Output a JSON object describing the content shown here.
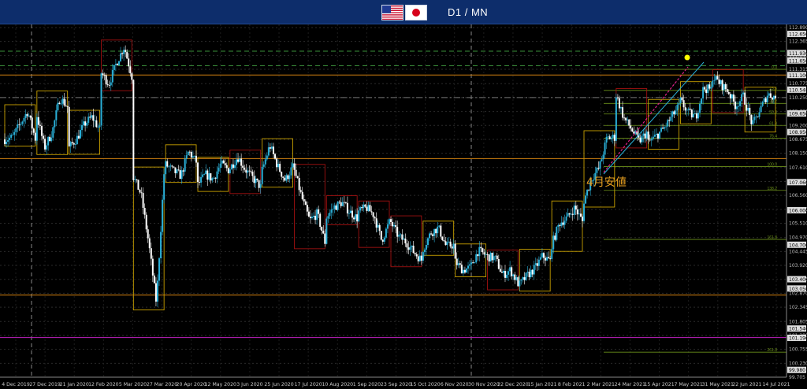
{
  "header": {
    "title": "D1 / MN",
    "flag_left": "us-flag-icon",
    "flag_right": "japan-flag-icon",
    "bar_color": "#0d2d6b"
  },
  "annotation": {
    "text": "4月安値",
    "color": "#e8a020"
  },
  "colors": {
    "up_candle": "#2ab0d8",
    "down_candle": "#ffffff",
    "monthly_box_up": "#c8a000",
    "monthly_box_down": "#a01010",
    "fib_lines": "#6b8f1a",
    "horizontal_orange": "#d08010",
    "horizontal_magenta": "#c020c0",
    "green_dashed": "#3a8f3a",
    "marker_dot": "#ffff00"
  },
  "chart_data": {
    "type": "candlestick",
    "title": "D1 / MN",
    "ylim": [
      99.705,
      112.89
    ],
    "y_ticks": [
      "112.890",
      "112.365",
      "111.840",
      "111.315",
      "110.775",
      "110.250",
      "109.725",
      "109.200",
      "108.675",
      "108.150",
      "107.610",
      "107.085",
      "106.560",
      "106.035",
      "105.510",
      "104.970",
      "104.445",
      "103.920",
      "103.395",
      "102.870",
      "102.345",
      "101.805",
      "101.280",
      "100.755",
      "100.230",
      "99.705"
    ],
    "y_tick_values": [
      112.89,
      112.365,
      111.84,
      111.315,
      110.775,
      110.25,
      109.725,
      109.2,
      108.675,
      108.15,
      107.61,
      107.085,
      106.56,
      106.035,
      105.51,
      104.97,
      104.445,
      103.92,
      103.395,
      102.87,
      102.345,
      101.805,
      101.28,
      100.755,
      100.23,
      99.705
    ],
    "x_labels": [
      "4 Dec 2019",
      "27 Dec 2019",
      "21 Jan 2020",
      "12 Feb 2020",
      "5 Mar 2020",
      "27 Mar 2020",
      "20 Apr 2020",
      "12 May 2020",
      "3 Jun 2020",
      "25 Jun 2020",
      "17 Jul 2020",
      "10 Aug 2020",
      "1 Sep 2020",
      "23 Sep 2020",
      "15 Oct 2020",
      "6 Nov 2020",
      "30 Nov 2020",
      "22 Dec 2020",
      "15 Jan 2021",
      "8 Feb 2021",
      "2 Mar 2021",
      "24 Mar 2021",
      "15 Apr 2021",
      "7 May 2021",
      "31 May 2021",
      "22 Jun 2021",
      "14 Jul 2021"
    ],
    "fib_labels": [
      "0.0",
      "23.6",
      "38.2",
      "50.0",
      "61.8",
      "76.4",
      "100.0",
      "138.2",
      "161.8",
      "261.8"
    ],
    "fib_levels": [
      111.315,
      110.52,
      110.03,
      109.63,
      109.2,
      108.72,
      107.65,
      106.75,
      104.9,
      100.65
    ],
    "price_labels": [
      "112.650",
      "111.930",
      "111.650",
      "111.100",
      "110.548",
      "109.650",
      "108.950",
      "107.060",
      "106.000",
      "104.700",
      "103.400",
      "103.050",
      "101.540",
      "101.190",
      "99.980"
    ],
    "price_label_values": [
      112.65,
      111.93,
      111.65,
      111.1,
      110.548,
      109.65,
      108.95,
      107.06,
      106.0,
      104.7,
      103.4,
      103.05,
      101.54,
      101.19,
      99.98
    ],
    "horizontal_levels": {
      "green_dashed": [
        112.0,
        111.45
      ],
      "orange": [
        111.1,
        107.95,
        102.8
      ],
      "magenta": [
        101.2
      ],
      "grey_dashdot": [
        110.25
      ]
    },
    "monthly_closes": [
      [
        108.67,
        108.75,
        109.25,
        109.73,
        108.7
      ],
      [
        109.57,
        108.35,
        108.95,
        110.25,
        109.9
      ],
      [
        108.36,
        108.7,
        109.25,
        109.52,
        109.04
      ],
      [
        111.18,
        110.76,
        111.57,
        112.17,
        111.05
      ],
      [
        107.25,
        106.6,
        104.75,
        102.49,
        107.38
      ],
      [
        107.72,
        107.48,
        107.3,
        108.22,
        107.83
      ],
      [
        106.96,
        107.35,
        107.17,
        107.75,
        107.53
      ],
      [
        107.59,
        108.02,
        107.54,
        107.2,
        106.88
      ],
      [
        107.51,
        108.45,
        107.68,
        107.12,
        107.64
      ],
      [
        107.48,
        106.45,
        105.6,
        105.88,
        104.8
      ],
      [
        105.75,
        106.12,
        106.3,
        105.95,
        105.7
      ],
      [
        105.95,
        106.1,
        105.82,
        104.85,
        105.54
      ],
      [
        105.54,
        105.01,
        104.8,
        104.42,
        104.12
      ],
      [
        104.55,
        105.15,
        105.34,
        104.65,
        104.69
      ],
      [
        104.05,
        103.74,
        103.85,
        104.48,
        104.3
      ],
      [
        104.25,
        104.2,
        103.55,
        103.75,
        103.25
      ],
      [
        103.2,
        103.54,
        103.81,
        104.28,
        104.08
      ],
      [
        104.7,
        105.52,
        105.71,
        106.1,
        105.58
      ],
      [
        106.37,
        107.2,
        107.6,
        108.72,
        108.75
      ],
      [
        110.34,
        109.48,
        109.06,
        108.6,
        108.93
      ],
      [
        108.55,
        108.8,
        109.07,
        109.5,
        109.93
      ],
      [
        110.12,
        109.68,
        109.51,
        110.6,
        110.55
      ],
      [
        111.05,
        110.77,
        110.5,
        109.93,
        110.3
      ],
      [
        110.12,
        109.2,
        109.8,
        110.39,
        110.25
      ]
    ]
  }
}
